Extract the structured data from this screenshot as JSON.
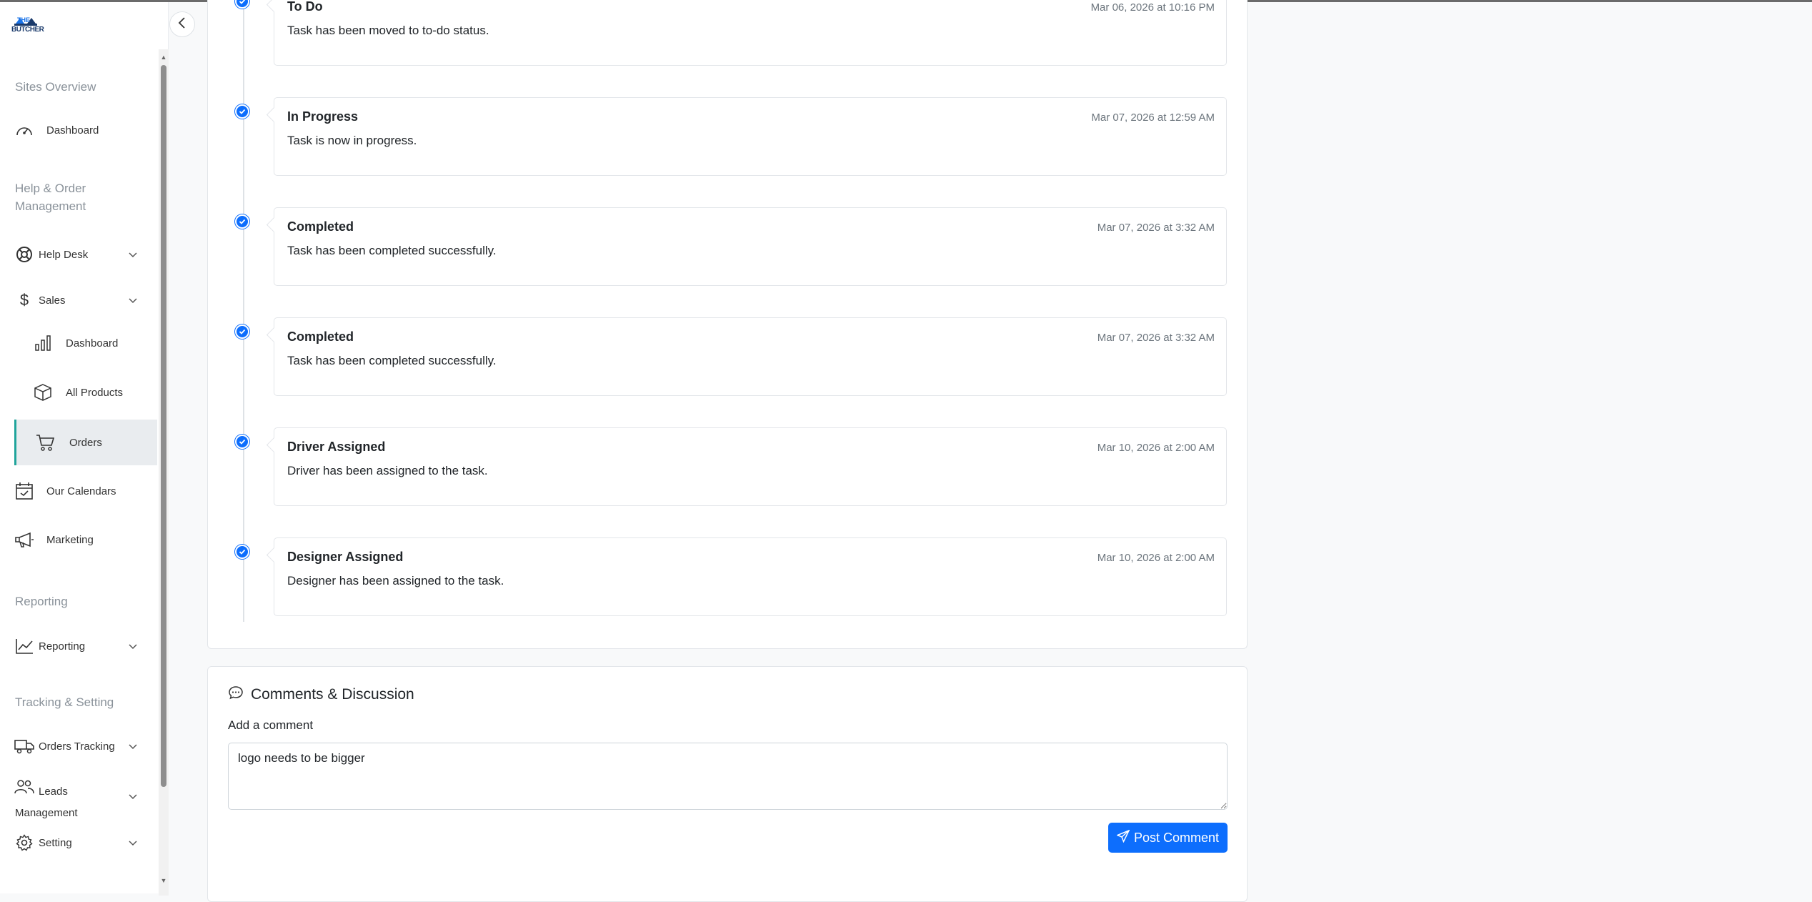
{
  "brand": {
    "logo_top": "THE",
    "logo_text": "BUTCHER"
  },
  "sidebar": {
    "sections": {
      "sites_overview": "Sites Overview",
      "help_order": "Help & Order Management",
      "reporting": "Reporting",
      "tracking": "Tracking & Setting"
    },
    "items": {
      "dashboard": "Dashboard",
      "help_desk": "Help Desk",
      "sales": "Sales",
      "sales_dashboard": "Dashboard",
      "all_products": "All Products",
      "orders": "Orders",
      "our_calendars": "Our Calendars",
      "marketing": "Marketing",
      "reporting": "Reporting",
      "orders_tracking": "Orders Tracking",
      "leads_management": "Leads Management",
      "setting": "Setting"
    }
  },
  "timeline": [
    {
      "title": "To Do",
      "date": "Mar 06, 2026 at 10:16 PM",
      "desc": "Task has been moved to to-do status."
    },
    {
      "title": "In Progress",
      "date": "Mar 07, 2026 at 12:59 AM",
      "desc": "Task is now in progress."
    },
    {
      "title": "Completed",
      "date": "Mar 07, 2026 at 3:32 AM",
      "desc": "Task has been completed successfully."
    },
    {
      "title": "Completed",
      "date": "Mar 07, 2026 at 3:32 AM",
      "desc": "Task has been completed successfully."
    },
    {
      "title": "Driver Assigned",
      "date": "Mar 10, 2026 at 2:00 AM",
      "desc": "Driver has been assigned to the task."
    },
    {
      "title": "Designer Assigned",
      "date": "Mar 10, 2026 at 2:00 AM",
      "desc": "Designer has been assigned to the task."
    }
  ],
  "comments": {
    "title": "Comments & Discussion",
    "label": "Add a comment",
    "value": "logo needs to be bigger",
    "button": "Post Comment"
  },
  "colors": {
    "accent": "#0d6efd",
    "active_border": "#20a49b"
  }
}
